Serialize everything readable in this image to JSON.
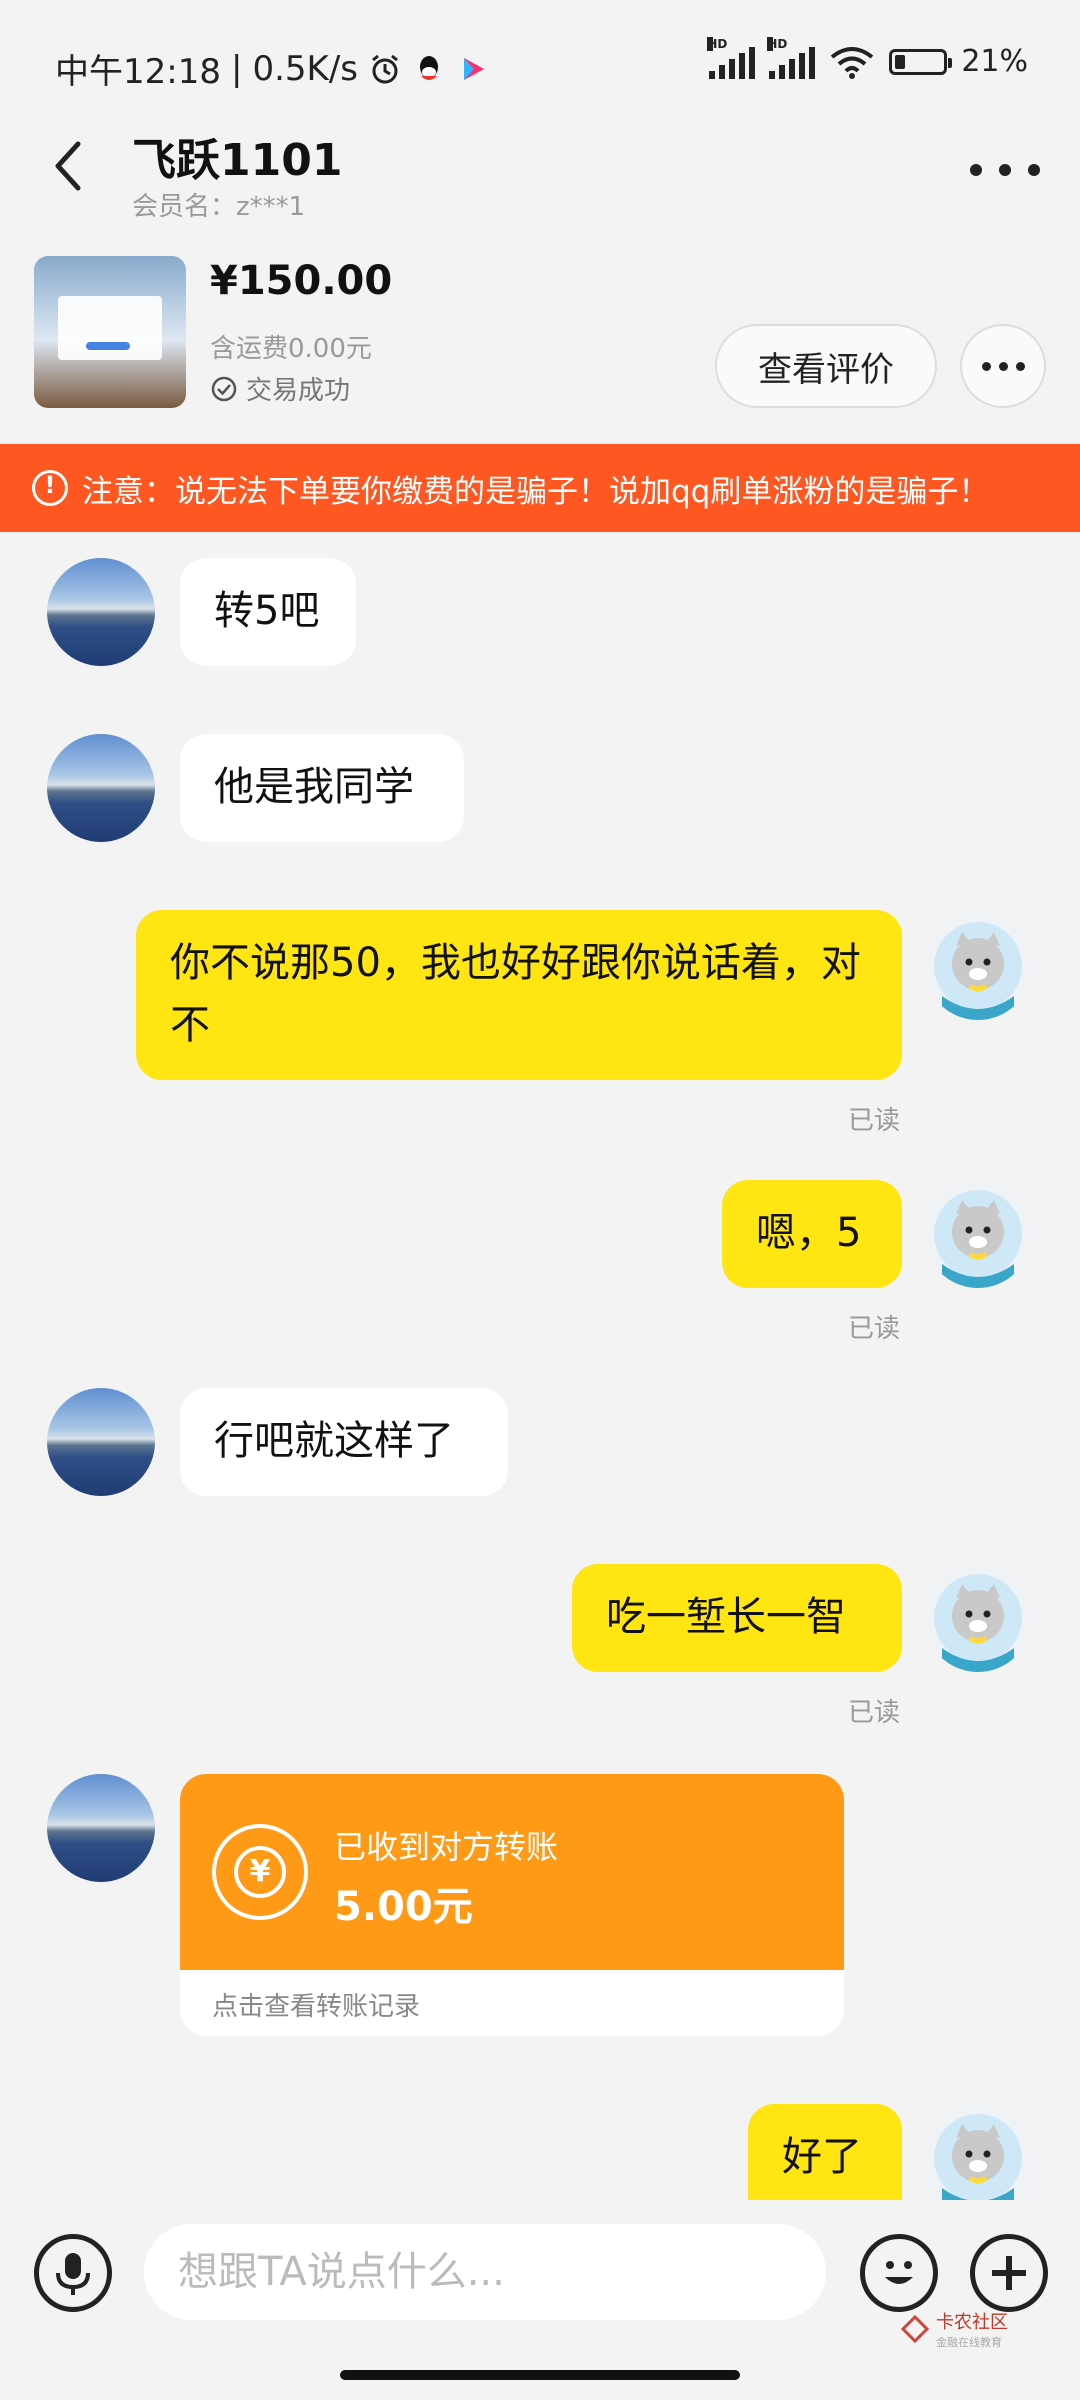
{
  "status_bar": {
    "time_prefix": "中午12:18",
    "network_speed": "0.5K/s",
    "battery_percent": "21%",
    "battery_level": 0.21
  },
  "header": {
    "title": "飞跃1101",
    "member_label": "会员名：z***1"
  },
  "product": {
    "price": "¥150.00",
    "shipping": "含运费0.00元",
    "status": "交易成功",
    "review_button": "查看评价"
  },
  "warning": {
    "text": "注意：说无法下单要你缴费的是骗子！说加qq刷单涨粉的是骗子！"
  },
  "messages": [
    {
      "side": "left",
      "text": "转5吧"
    },
    {
      "side": "left",
      "text": "他是我同学"
    },
    {
      "side": "right",
      "text": "你不说那50，我也好好跟你说话着，对不",
      "read": "已读"
    },
    {
      "side": "right",
      "text": "嗯，5",
      "read": "已读"
    },
    {
      "side": "left",
      "text": "行吧就这样了"
    },
    {
      "side": "right",
      "text": "吃一堑长一智",
      "read": "已读"
    },
    {
      "side": "right",
      "text": "好了"
    }
  ],
  "transfer": {
    "title": "已收到对方转账",
    "amount": "5.00元",
    "link": "点击查看转账记录",
    "icon_symbol": "¥"
  },
  "composer": {
    "placeholder": "想跟TA说点什么..."
  },
  "watermark": {
    "text": "卡农社区",
    "sub": "金融在线教育"
  },
  "colors": {
    "accent_yellow": "#ffe511",
    "warning_orange": "#ff5722",
    "transfer_orange": "#ff9a16",
    "background": "#f3f3f3"
  }
}
